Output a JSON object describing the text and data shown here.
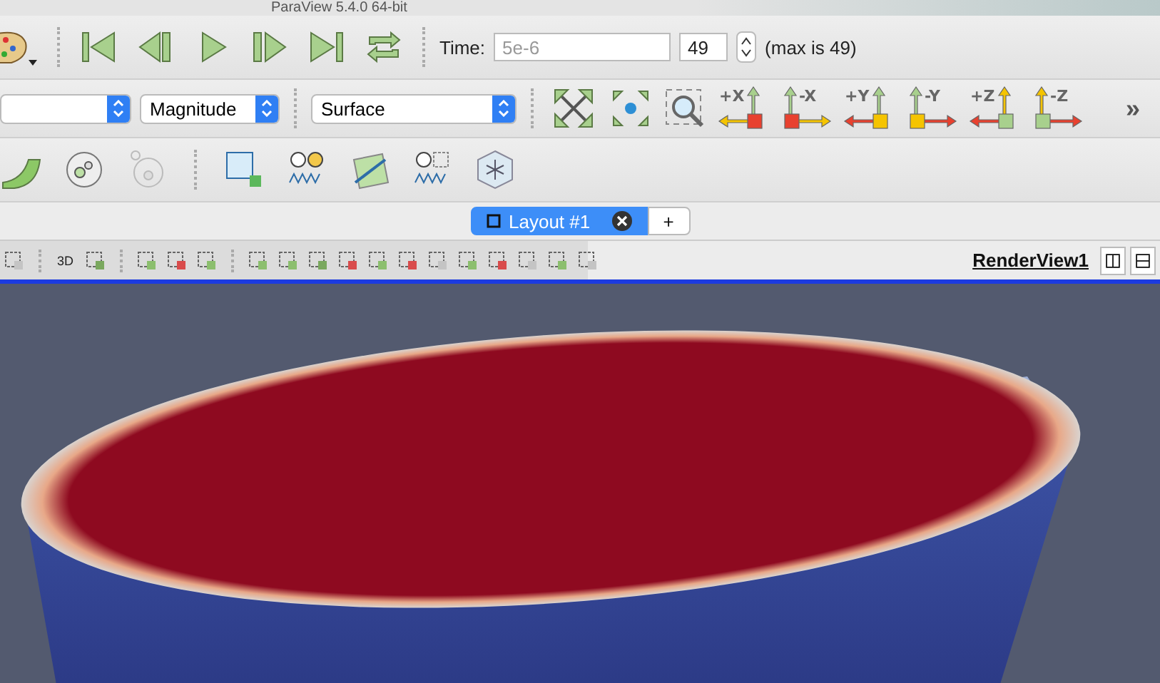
{
  "window": {
    "title": "ParaView 5.4.0 64-bit"
  },
  "time_toolbar": {
    "time_label": "Time:",
    "time_value": "5e-6",
    "step_value": "49",
    "max_label": "(max is 49)"
  },
  "display_toolbar": {
    "combos": [
      {
        "value": "Magnitude"
      },
      {
        "value": "Surface"
      }
    ]
  },
  "camera_toolbar": {
    "axes": [
      {
        "label": "+X"
      },
      {
        "label": "-X"
      },
      {
        "label": "+Y"
      },
      {
        "label": "-Y"
      },
      {
        "label": "+Z"
      },
      {
        "label": "-Z"
      }
    ],
    "overflow": "»"
  },
  "tabs": [
    {
      "label": "Layout #1",
      "selected": true
    },
    {
      "label": "+",
      "selected": false
    }
  ],
  "view_toolbar": {
    "mode_button": "3D",
    "view_name": "RenderView1"
  }
}
